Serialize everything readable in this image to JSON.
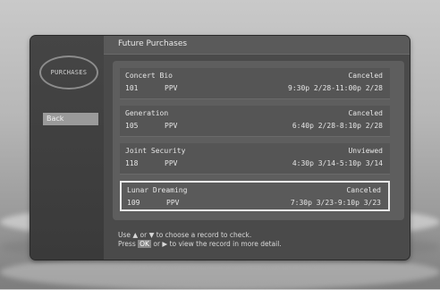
{
  "app": {
    "logo_text": "PURCHASES",
    "title": "Future Purchases"
  },
  "sidebar": {
    "back_label": "Back"
  },
  "records": [
    {
      "program": "Concert Bio",
      "status": "Canceled",
      "channel": "101",
      "service": "PPV",
      "time": "9:30p 2/28-11:00p 2/28"
    },
    {
      "program": "Generation",
      "status": "Canceled",
      "channel": "105",
      "service": "PPV",
      "time": "6:40p 2/28-8:10p 2/28"
    },
    {
      "program": "Joint Security",
      "status": "Unviewed",
      "channel": "118",
      "service": "PPV",
      "time": "4:30p 3/14-5:10p 3/14"
    },
    {
      "program": "Lunar Dreaming",
      "status": "Canceled",
      "channel": "109",
      "service": "PPV",
      "time": "7:30p 3/23-9:10p 3/23"
    }
  ],
  "help": {
    "line1": "Use ▲ or ▼ to choose a record to check.",
    "line2_pre": "Press",
    "ok_label": "OK",
    "line2_post": "or ▶ to view the record in more detail."
  }
}
